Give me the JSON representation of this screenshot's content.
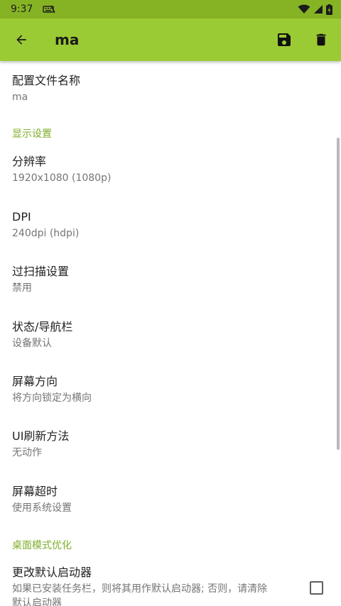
{
  "status_bar": {
    "time": "9:37",
    "icons": [
      "keyboard-notification-icon",
      "wifi-icon",
      "cell-signal-icon",
      "battery-icon"
    ]
  },
  "app_bar": {
    "title": "ma",
    "back_icon": "arrow-back-icon",
    "save_icon": "save-icon",
    "delete_icon": "delete-icon"
  },
  "preferences": {
    "profile_name": {
      "title": "配置文件名称",
      "summary": "ma"
    },
    "display_category": "显示设置",
    "resolution": {
      "title": "分辨率",
      "summary": "1920x1080 (1080p)"
    },
    "dpi": {
      "title": "DPI",
      "summary": "240dpi (hdpi)"
    },
    "overscan": {
      "title": "过扫描设置",
      "summary": "禁用"
    },
    "status_nav_bar": {
      "title": "状态/导航栏",
      "summary": "设备默认"
    },
    "orientation": {
      "title": "屏幕方向",
      "summary": "将方向锁定为横向"
    },
    "ui_refresh": {
      "title": "UI刷新方法",
      "summary": "无动作"
    },
    "screen_timeout": {
      "title": "屏幕超时",
      "summary": "使用系统设置"
    },
    "desktop_category": "桌面模式优化",
    "default_launcher": {
      "title": "更改默认启动器",
      "summary_line1": "如果已安装任务栏，则将其用作默认启动器; 否则，请清除",
      "summary_line2": "默认启动器",
      "checked": false
    }
  },
  "colors": {
    "status_bar": "#86b324",
    "app_bar": "#9bcb34",
    "accent": "#7fae2a"
  }
}
